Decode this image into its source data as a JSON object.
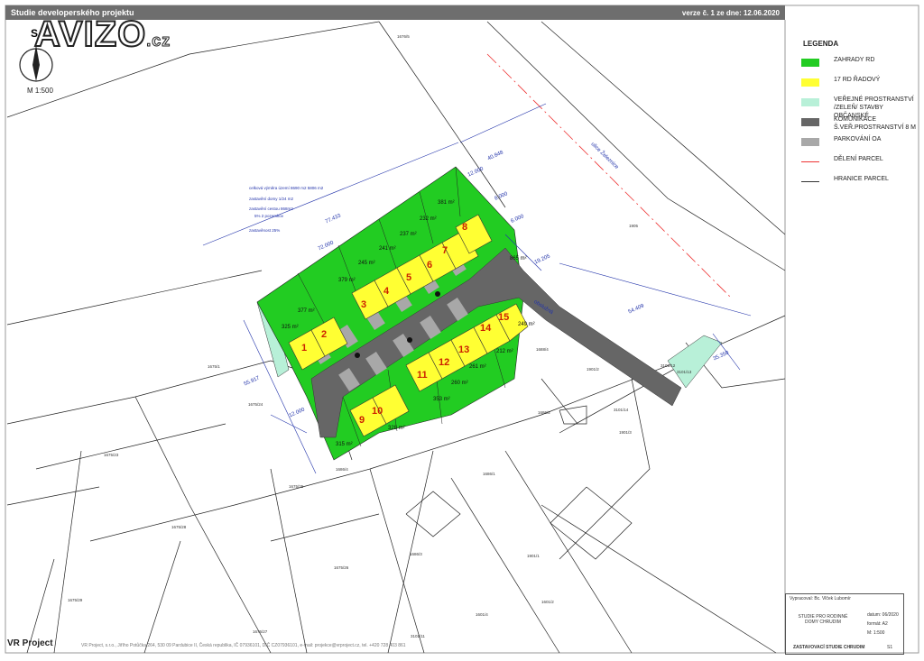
{
  "header": {
    "title": "Studie developerského projektu",
    "version": "verze č. 1 ze dne: 12.06.2020"
  },
  "branding": {
    "watermark": "AVIZO",
    "watermark_suffix": ".cz",
    "scale": "M 1:500",
    "north": "S"
  },
  "legend": {
    "title": "LEGENDA",
    "items": [
      {
        "label": "ZAHRADY RD",
        "color": "#22cc22",
        "kind": "fill"
      },
      {
        "label": "17 RD ŘADOVÝ",
        "color": "#ffff33",
        "kind": "fill"
      },
      {
        "label": "VEŘEJNÉ PROSTRANSTVÍ /ZELEŇ/ STAVBY OBČANSKÉ",
        "color": "#b8f0d8",
        "kind": "fill"
      },
      {
        "label": "KOMUNIKACE Š.VEŘ.PROSTRANSTVÍ 8 M",
        "color": "#666666",
        "kind": "fill"
      },
      {
        "label": "PARKOVÁNÍ OA",
        "color": "#a8a8a8",
        "kind": "fill"
      },
      {
        "label": "DĚLENÍ PARCEL",
        "color": "#ee3333",
        "kind": "line"
      },
      {
        "label": "HRANICE PARCEL",
        "color": "#333333",
        "kind": "line"
      }
    ]
  },
  "stats": {
    "line1": "celková výměra území 8690 m2   5806 m2",
    "line2": "zastavění domy 1/24 m2",
    "line3": "zastavění cestou 868m2",
    "line4": "5% 2 pozemkov",
    "line5": "zastavěnost 25%"
  },
  "lots": [
    {
      "n": "1"
    },
    {
      "n": "2"
    },
    {
      "n": "3"
    },
    {
      "n": "4"
    },
    {
      "n": "5"
    },
    {
      "n": "6"
    },
    {
      "n": "7"
    },
    {
      "n": "8"
    },
    {
      "n": "9"
    },
    {
      "n": "10"
    },
    {
      "n": "11"
    },
    {
      "n": "12"
    },
    {
      "n": "13"
    },
    {
      "n": "14"
    },
    {
      "n": "15"
    }
  ],
  "areas": [
    "381 m²",
    "232 m²",
    "237 m²",
    "241 m²",
    "245 m²",
    "379 m²",
    "377 m²",
    "325 m²",
    "865 m²",
    "249 m²",
    "212 m²",
    "261 m²",
    "260 m²",
    "353 m²",
    "328 m²",
    "315 m²"
  ],
  "dimensions": [
    "77.433",
    "40.848",
    "12.000",
    "8.000",
    "6.000",
    "19.205",
    "54.409",
    "55.917",
    "12.000",
    "35.350",
    "72.000"
  ],
  "parcels": [
    "1676/5",
    "1905",
    "1675/1",
    "1675/24",
    "1675/23",
    "1675/25",
    "1675/28",
    "1675/26",
    "1675/29",
    "1675/27",
    "1686/1",
    "1686/3",
    "1686/4",
    "1686/2",
    "1688/4",
    "3101/12",
    "3101/14",
    "1901/2",
    "1901/3",
    "1901/1",
    "1601/4",
    "3101/11",
    "3101/13",
    "1601/2"
  ],
  "labels": {
    "road": "ulice Železnice",
    "access": "obslužná"
  },
  "titleblock": {
    "author": "Vypracoval: Bc. Vlček Lubomír",
    "project": "STUDIE PRO RODINNÉ DOMY CHRUDIM",
    "date": "datum: 06/2020",
    "format": "formát: A2",
    "scale": "M: 1:500",
    "sheet": "ZASTAVOVACÍ STUDIE CHRUDIM",
    "sheet_no": "S1"
  },
  "footer": {
    "company": "VR Project",
    "sub": "Project",
    "contact": "VR Project, s.r.o., Jiřího Potůčka 264, 530 09 Pardubice II, Česká republika, IČ 07936101, DIČ CZ07936101, e-mail: projekce@vrproject.cz, tel. +420 728 403 861"
  }
}
